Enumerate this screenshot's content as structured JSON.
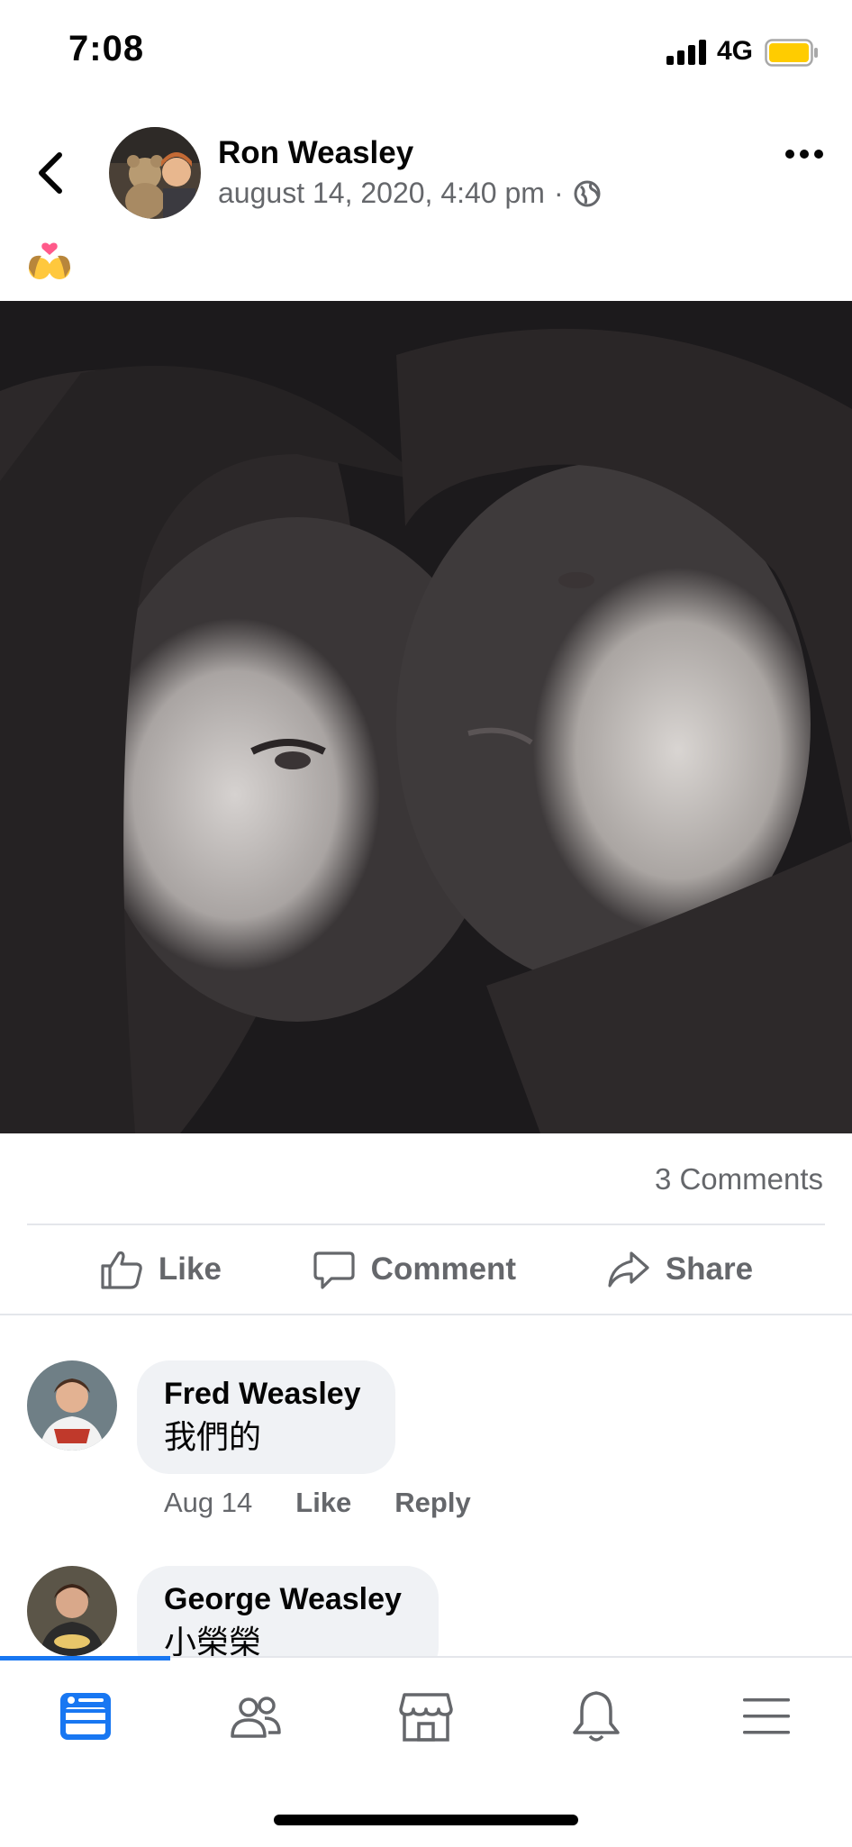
{
  "status_bar": {
    "time": "7:08",
    "network": "4G",
    "battery_color": "#ffcc00"
  },
  "post": {
    "author": "Ron Weasley",
    "timestamp": "august 14, 2020, 4:40 pm",
    "separator": "·",
    "privacy_icon": "globe-icon",
    "caption_emoji": "kiss-emoji",
    "comments_count": "3 Comments"
  },
  "actions": {
    "like_label": "Like",
    "comment_label": "Comment",
    "share_label": "Share"
  },
  "comments": [
    {
      "name": "Fred Weasley",
      "text": "我們的",
      "date": "Aug 14",
      "like_label": "Like",
      "reply_label": "Reply"
    },
    {
      "name": "George Weasley",
      "text": "小榮榮"
    }
  ],
  "tab_bar": {
    "active_color": "#1877f2",
    "icons": [
      "news-feed-icon",
      "friends-icon",
      "marketplace-icon",
      "notifications-icon",
      "menu-icon"
    ]
  }
}
